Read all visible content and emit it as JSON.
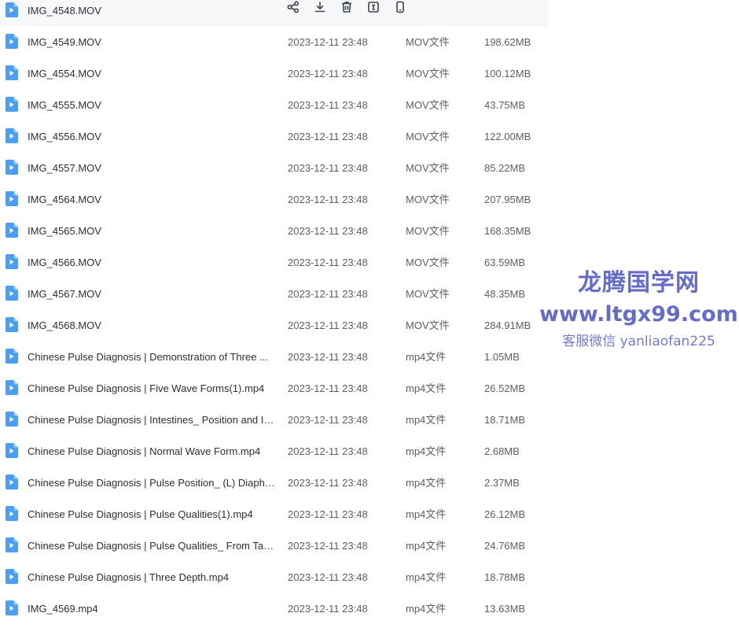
{
  "hover_actions": [
    "share-icon",
    "download-icon",
    "delete-icon",
    "rename-icon",
    "mobile-icon"
  ],
  "files": [
    {
      "name": "IMG_4548.MOV",
      "date": "",
      "type": "",
      "size": "",
      "hovered": true
    },
    {
      "name": "IMG_4549.MOV",
      "date": "2023-12-11 23:48",
      "type": "MOV文件",
      "size": "198.62MB"
    },
    {
      "name": "IMG_4554.MOV",
      "date": "2023-12-11 23:48",
      "type": "MOV文件",
      "size": "100.12MB"
    },
    {
      "name": "IMG_4555.MOV",
      "date": "2023-12-11 23:48",
      "type": "MOV文件",
      "size": "43.75MB"
    },
    {
      "name": "IMG_4556.MOV",
      "date": "2023-12-11 23:48",
      "type": "MOV文件",
      "size": "122.00MB"
    },
    {
      "name": "IMG_4557.MOV",
      "date": "2023-12-11 23:48",
      "type": "MOV文件",
      "size": "85.22MB"
    },
    {
      "name": "IMG_4564.MOV",
      "date": "2023-12-11 23:48",
      "type": "MOV文件",
      "size": "207.95MB"
    },
    {
      "name": "IMG_4565.MOV",
      "date": "2023-12-11 23:48",
      "type": "MOV文件",
      "size": "168.35MB"
    },
    {
      "name": "IMG_4566.MOV",
      "date": "2023-12-11 23:48",
      "type": "MOV文件",
      "size": "63.59MB"
    },
    {
      "name": "IMG_4567.MOV",
      "date": "2023-12-11 23:48",
      "type": "MOV文件",
      "size": "48.35MB"
    },
    {
      "name": "IMG_4568.MOV",
      "date": "2023-12-11 23:48",
      "type": "MOV文件",
      "size": "284.91MB"
    },
    {
      "name": "Chinese Pulse Diagnosis  | Demonstration of Three ...",
      "date": "2023-12-11 23:48",
      "type": "mp4文件",
      "size": "1.05MB"
    },
    {
      "name": "Chinese Pulse Diagnosis | Five Wave Forms(1).mp4",
      "date": "2023-12-11 23:48",
      "type": "mp4文件",
      "size": "26.52MB"
    },
    {
      "name": "Chinese Pulse Diagnosis | Intestines_ Position and In...",
      "date": "2023-12-11 23:48",
      "type": "mp4文件",
      "size": "18.71MB"
    },
    {
      "name": "Chinese Pulse Diagnosis | Normal Wave Form.mp4",
      "date": "2023-12-11 23:48",
      "type": "mp4文件",
      "size": "2.68MB"
    },
    {
      "name": "Chinese Pulse Diagnosis | Pulse Position_ (L) Diaphra...",
      "date": "2023-12-11 23:48",
      "type": "mp4文件",
      "size": "2.37MB"
    },
    {
      "name": "Chinese Pulse Diagnosis | Pulse Qualities(1).mp4",
      "date": "2023-12-11 23:48",
      "type": "mp4文件",
      "size": "26.12MB"
    },
    {
      "name": "Chinese Pulse Diagnosis | Pulse Qualities_ From Taut...",
      "date": "2023-12-11 23:48",
      "type": "mp4文件",
      "size": "24.76MB"
    },
    {
      "name": "Chinese Pulse Diagnosis | Three Depth.mp4",
      "date": "2023-12-11 23:48",
      "type": "mp4文件",
      "size": "18.78MB"
    },
    {
      "name": "IMG_4569.mp4",
      "date": "2023-12-11 23:48",
      "type": "mp4文件",
      "size": "13.63MB"
    }
  ],
  "watermark": {
    "title": "龙腾国学网",
    "url": "www.ltgx99.com",
    "contact": "客服微信 yanliaofan225"
  },
  "colors": {
    "file_icon": "#4a9ff5",
    "hover_row": "#f7f8fa",
    "watermark": "#4a52c0"
  }
}
